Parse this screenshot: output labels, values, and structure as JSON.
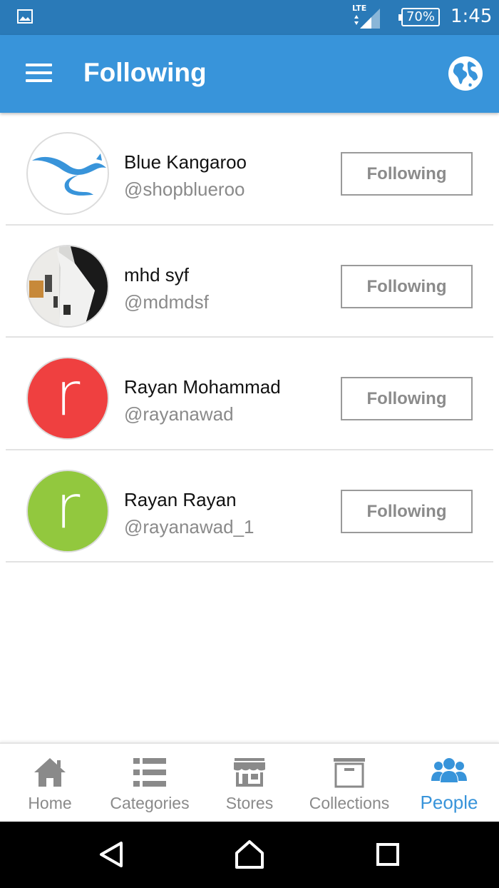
{
  "status_bar": {
    "network": "LTE",
    "battery": "70%",
    "time": "1:45"
  },
  "app_bar": {
    "title": "Following"
  },
  "following": [
    {
      "name": "Blue Kangaroo",
      "handle": "@shopblueroo",
      "button": "Following",
      "avatar": "kangaroo-logo"
    },
    {
      "name": "mhd syf",
      "handle": "@mdmdsf",
      "button": "Following",
      "avatar": "photo"
    },
    {
      "name": "Rayan Mohammad",
      "handle": "@rayanawad",
      "button": "Following",
      "avatar_letter": "r",
      "avatar_color": "#ef4040"
    },
    {
      "name": "Rayan Rayan",
      "handle": "@rayanawad_1",
      "button": "Following",
      "avatar_letter": "r",
      "avatar_color": "#92c83e"
    }
  ],
  "bottom_nav": [
    {
      "label": "Home",
      "icon": "home-icon"
    },
    {
      "label": "Categories",
      "icon": "list-icon"
    },
    {
      "label": "Stores",
      "icon": "store-icon"
    },
    {
      "label": "Collections",
      "icon": "archive-icon"
    },
    {
      "label": "People",
      "icon": "people-icon",
      "active": true
    }
  ],
  "colors": {
    "status_bar": "#2a7ab8",
    "app_bar": "#3894da",
    "active_tab": "#3894da",
    "inactive": "#8a8a8a"
  }
}
